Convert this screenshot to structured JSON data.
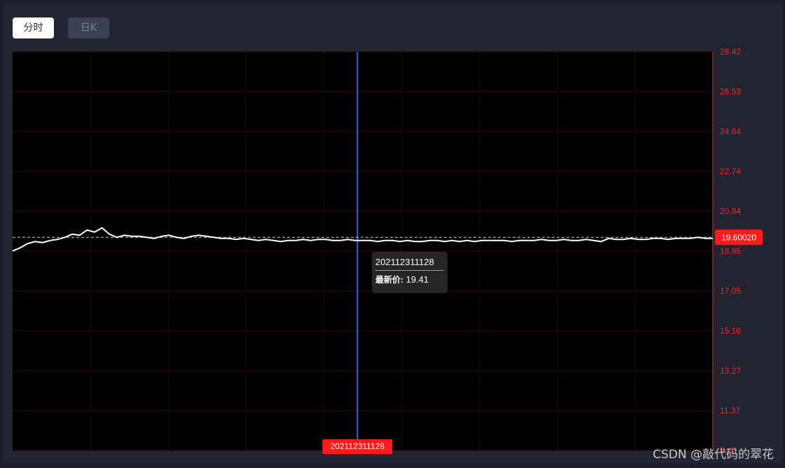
{
  "tabs": [
    {
      "label": "分时",
      "active": true
    },
    {
      "label": "日K",
      "active": false
    }
  ],
  "chart_data": {
    "type": "line",
    "yticks": [
      "28.42",
      "26.53",
      "24.64",
      "22.74",
      "20.84",
      "18.95",
      "17.05",
      "15.16",
      "13.27",
      "11.37",
      "9.47"
    ],
    "ylim": [
      9.47,
      28.42
    ],
    "reference_price": 19.6002,
    "reference_label": "19.60020",
    "crosshair_label": "202112311128",
    "crosshair_fraction": 0.4924,
    "series": [
      {
        "values": [
          18.95,
          19.1,
          19.3,
          19.4,
          19.35,
          19.45,
          19.5,
          19.6,
          19.75,
          19.7,
          19.95,
          19.85,
          20.05,
          19.75,
          19.6,
          19.7,
          19.65,
          19.65,
          19.6,
          19.55,
          19.65,
          19.7,
          19.6,
          19.55,
          19.65,
          19.7,
          19.65,
          19.6,
          19.55,
          19.55,
          19.5,
          19.55,
          19.5,
          19.45,
          19.5,
          19.45,
          19.4,
          19.45,
          19.45,
          19.5,
          19.45,
          19.5,
          19.5,
          19.45,
          19.45,
          19.5,
          19.45,
          19.45,
          19.45,
          19.4,
          19.45,
          19.45,
          19.4,
          19.45,
          19.4,
          19.4,
          19.45,
          19.45,
          19.4,
          19.45,
          19.4,
          19.45,
          19.4,
          19.45,
          19.45,
          19.45,
          19.45,
          19.4,
          19.45,
          19.45,
          19.45,
          19.5,
          19.45,
          19.45,
          19.5,
          19.45,
          19.45,
          19.5,
          19.45,
          19.4,
          19.55,
          19.5,
          19.5,
          19.55,
          19.5,
          19.5,
          19.55,
          19.55,
          19.5,
          19.55,
          19.55,
          19.55,
          19.6,
          19.55,
          19.55
        ]
      }
    ]
  },
  "tooltip": {
    "title": "202112311128",
    "label": "最新价:",
    "value": "19.41"
  },
  "watermark": "CSDN @敲代码的翠花",
  "colors": {
    "axis": "#ff2222",
    "grid": "#3a0c0c",
    "line": "#ffffff",
    "crosshair": "#4a5fe0",
    "tag_bg": "#ff1a1a"
  }
}
